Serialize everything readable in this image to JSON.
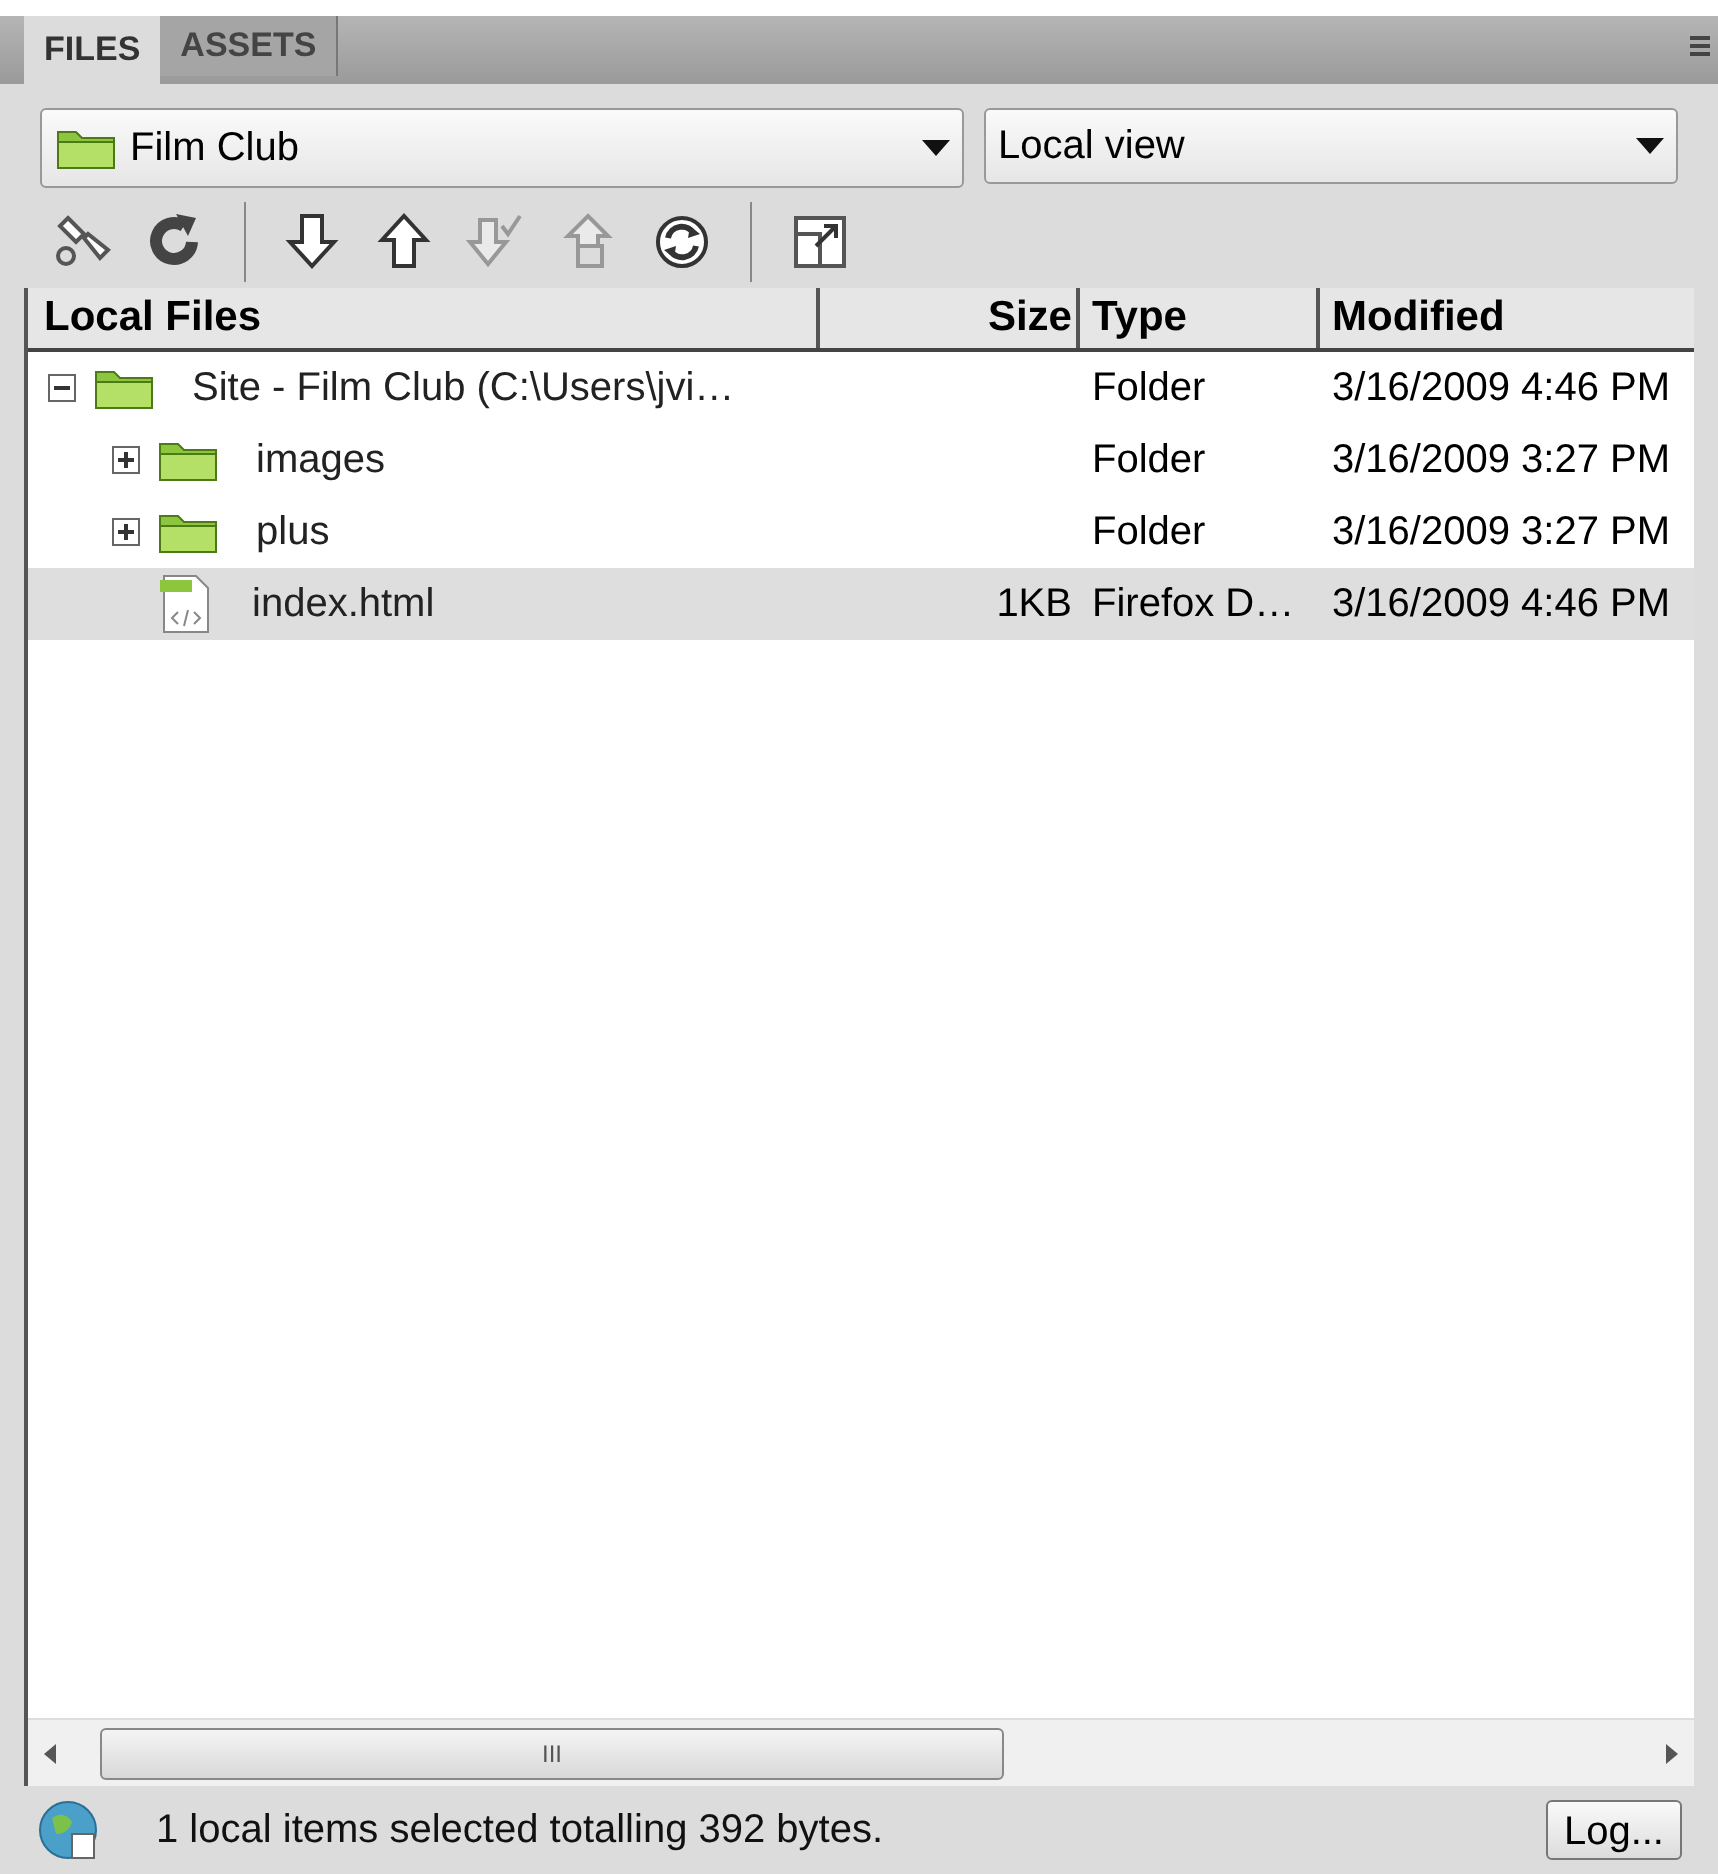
{
  "tabs": [
    {
      "label": "FILES",
      "selected": true
    },
    {
      "label": "ASSETS",
      "selected": false
    }
  ],
  "site_select": {
    "value": "Film Club"
  },
  "view_select": {
    "value": "Local view"
  },
  "toolbar": [
    {
      "kind": "connect",
      "disabled": false
    },
    {
      "kind": "refresh",
      "disabled": false
    },
    {
      "kind": "sep"
    },
    {
      "kind": "get",
      "disabled": false
    },
    {
      "kind": "put",
      "disabled": false
    },
    {
      "kind": "checkout",
      "disabled": true
    },
    {
      "kind": "checkin",
      "disabled": true
    },
    {
      "kind": "sync",
      "disabled": false
    },
    {
      "kind": "sep"
    },
    {
      "kind": "expand",
      "disabled": false
    }
  ],
  "table": {
    "columns": [
      "Local Files",
      "Size",
      "Type",
      "Modified"
    ],
    "rows": [
      {
        "kind": "folder",
        "name": "Site - Film Club (C:\\Users\\jvi…",
        "type": "Folder",
        "modified": "3/16/2009 4:46 PM",
        "expanded": true,
        "selected": false,
        "children": [
          {
            "kind": "folder",
            "name": "images",
            "type": "Folder",
            "modified": "3/16/2009 3:27 PM",
            "expanded": false,
            "selected": false
          },
          {
            "kind": "folder",
            "name": "plus",
            "type": "Folder",
            "modified": "3/16/2009 3:27 PM",
            "expanded": false,
            "selected": false
          },
          {
            "kind": "file",
            "name": "index.html",
            "size": "1KB",
            "type": "Firefox D…",
            "modified": "3/16/2009 4:46 PM",
            "selected": true
          }
        ]
      }
    ]
  },
  "scrollbar_grip": "III",
  "status_bar": {
    "text": "1 local items selected totalling 392 bytes.",
    "log_button": "Log..."
  }
}
